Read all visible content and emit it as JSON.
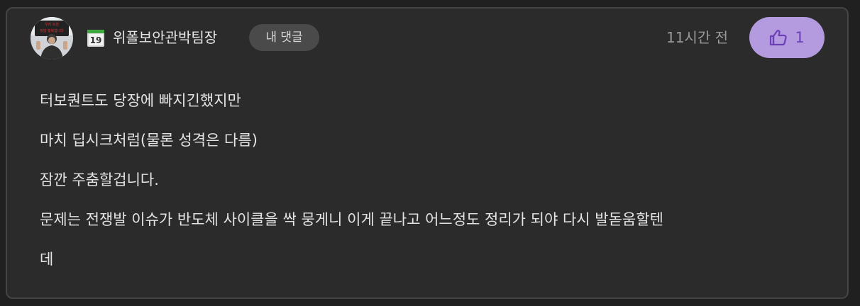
{
  "comment": {
    "author": {
      "nickname": "위폴보안관박팀장",
      "grade": "19",
      "avatar_sign_text": "우리 회원\n정말 행복합니다"
    },
    "my_comment_label": "내 댓글",
    "timestamp": "11시간 전",
    "likes": {
      "count": "1",
      "icon": "thumbs-up-icon"
    },
    "lines": [
      "터보퀀트도 당장에 빠지긴했지만",
      "마치 딥시크처럼(물론 성격은 다름)",
      "잠깐 주춤할겁니다.",
      "문제는 전쟁발 이슈가 반도체 사이클을 싹 뭉게니 이게 끝나고 어느정도 정리가 되야 다시 발돋움할텐",
      "데"
    ]
  },
  "colors": {
    "page_background": "#202020",
    "card_background": "#2b2b2b",
    "card_border": "#444444",
    "like_button_background": "#b49be0",
    "like_button_foreground": "#6a3fb8",
    "badge_background": "#4a4a4a",
    "grade_badge_accent": "#3fa83f",
    "text_primary": "#e4e4e4",
    "text_muted": "#9a9a9a"
  }
}
